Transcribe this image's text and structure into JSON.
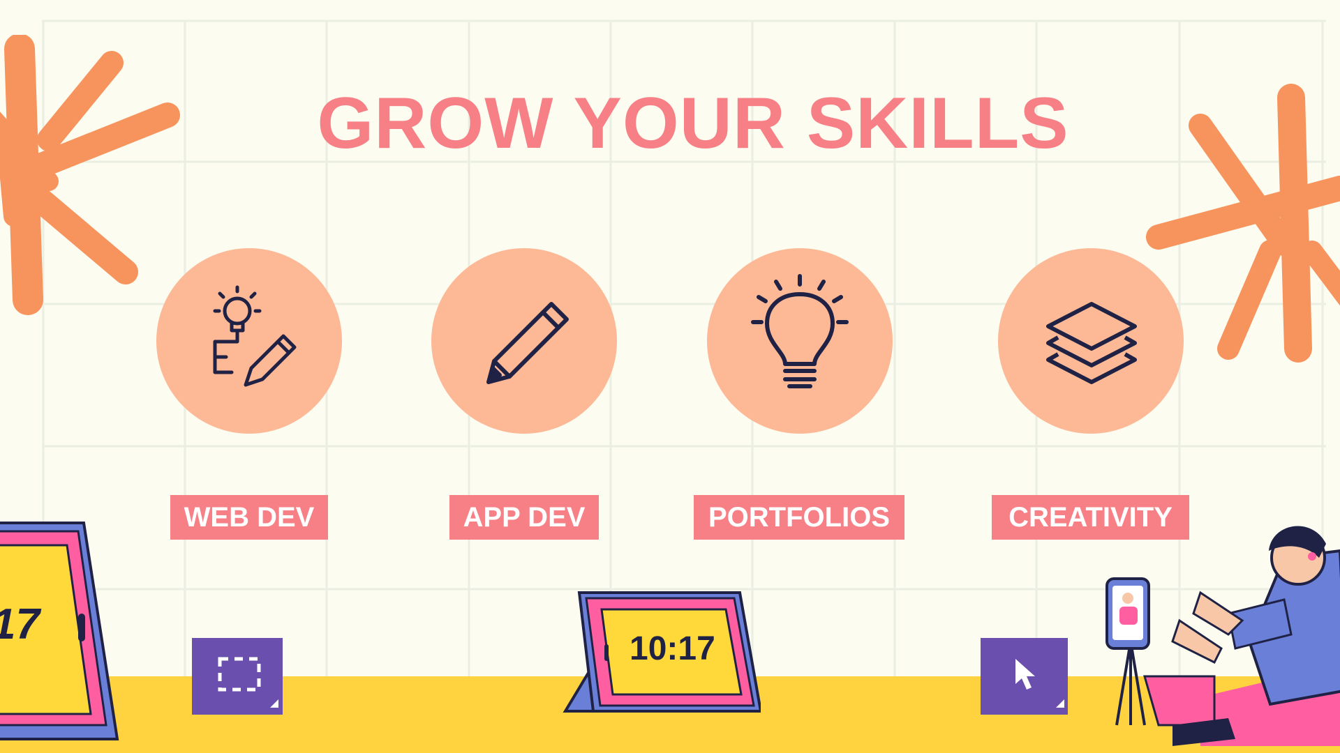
{
  "slide": {
    "title": "GROW YOUR SKILLS",
    "features": [
      {
        "label": "WEB DEV",
        "icon": "idea-sketch-icon"
      },
      {
        "label": "APP DEV",
        "icon": "pencil-icon"
      },
      {
        "label": "PORTFOLIOS",
        "icon": "lightbulb-icon"
      },
      {
        "label": "CREATIVITY",
        "icon": "layers-icon"
      }
    ],
    "tablet_clock": "10:17",
    "left_tablet_clock_fragment": "17"
  },
  "colors": {
    "background": "#fcfcf0",
    "title": "#f77f86",
    "circle": "#fdb895",
    "label_bg": "#f77f86",
    "floor": "#fed33f",
    "accent_purple": "#6b4faf",
    "splash_orange": "#f7935c",
    "icon_stroke": "#1f2244"
  }
}
